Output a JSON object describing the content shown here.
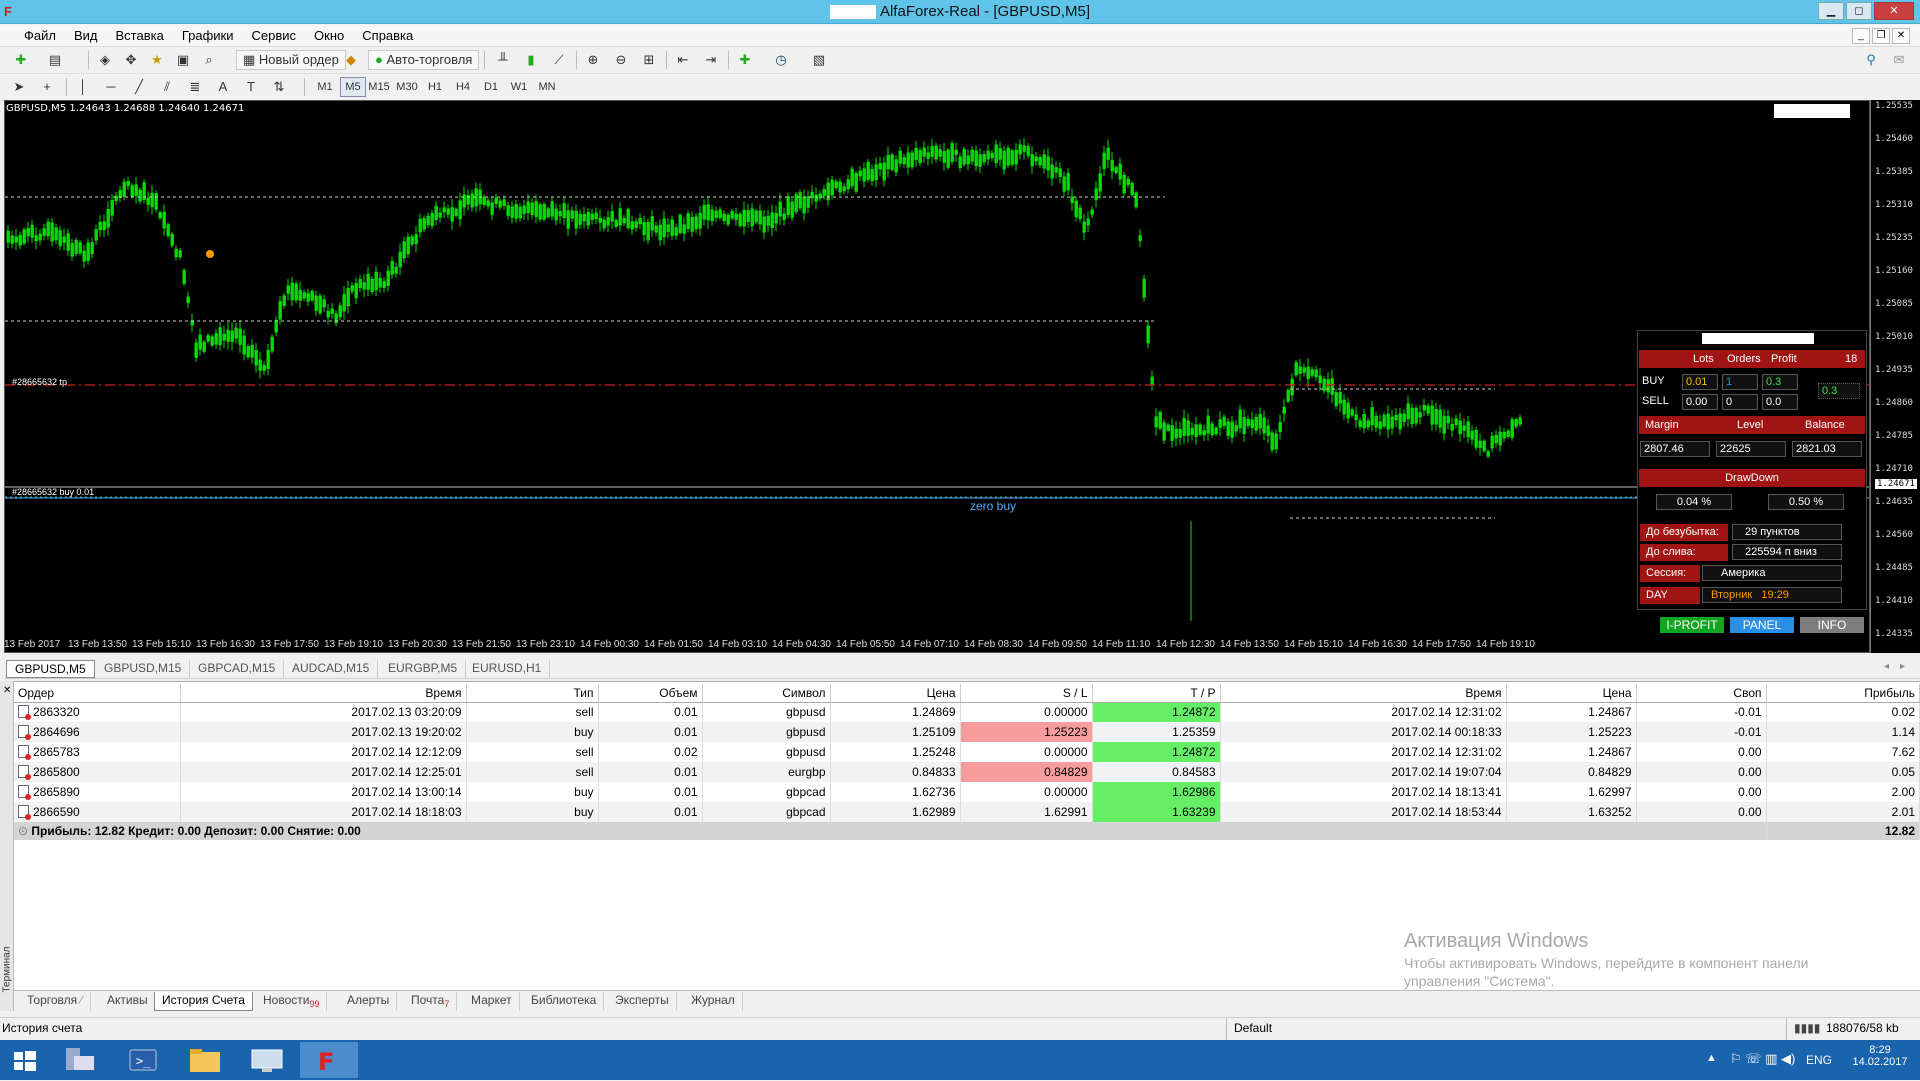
{
  "window": {
    "title": "AlfaForex-Real - [GBPUSD,M5]",
    "controls": {
      "minimize": "▁",
      "maximize": "◻",
      "close": "✕"
    }
  },
  "menu": [
    "Файл",
    "Вид",
    "Вставка",
    "Графики",
    "Сервис",
    "Окно",
    "Справка"
  ],
  "toolbar": {
    "new_order_label": "Новый ордер",
    "autotrade_label": "Авто-торговля",
    "timeframes": [
      "M1",
      "M5",
      "M15",
      "M30",
      "H1",
      "H4",
      "D1",
      "W1",
      "MN"
    ],
    "active_timeframe": "M5"
  },
  "chart": {
    "header": "GBPUSD,M5  1.24643 1.24688 1.24640 1.24671",
    "tp_label": "#28665632 tp",
    "buy_label": "#28665632 buy 0.01",
    "zero_buy_label": "zero buy",
    "current_price": "1.24671",
    "price_ticks": [
      "1.25535",
      "1.25460",
      "1.25385",
      "1.25310",
      "1.25235",
      "1.25160",
      "1.25085",
      "1.25010",
      "1.24935",
      "1.24860",
      "1.24785",
      "1.24710",
      "1.24635",
      "1.24560",
      "1.24485",
      "1.24410",
      "1.24335"
    ],
    "time_ticks": [
      "13 Feb 2017",
      "13 Feb 13:50",
      "13 Feb 15:10",
      "13 Feb 16:30",
      "13 Feb 17:50",
      "13 Feb 19:10",
      "13 Feb 20:30",
      "13 Feb 21:50",
      "13 Feb 23:10",
      "14 Feb 00:30",
      "14 Feb 01:50",
      "14 Feb 03:10",
      "14 Feb 04:30",
      "14 Feb 05:50",
      "14 Feb 07:10",
      "14 Feb 08:30",
      "14 Feb 09:50",
      "14 Feb 11:10",
      "14 Feb 12:30",
      "14 Feb 13:50",
      "14 Feb 15:10",
      "14 Feb 16:30",
      "14 Feb 17:50",
      "14 Feb 19:10"
    ],
    "colors": {
      "candles": "#00dd00",
      "tp_line": "#d02020",
      "zero_line": "#55aaff",
      "dotted": "#cccccc"
    }
  },
  "panel": {
    "col_lots": "Lots",
    "col_orders": "Orders",
    "col_profit": "Profit",
    "count": "18",
    "buy_label": "BUY",
    "sell_label": "SELL",
    "buy_lots": "0.01",
    "buy_orders": "1",
    "buy_profit": "0.3",
    "total_profit": "0.3",
    "sell_lots": "0.00",
    "sell_orders": "0",
    "sell_profit": "0.0",
    "margin_label": "Margin",
    "level_label": "Level",
    "balance_label": "Balance",
    "margin": "2807.46",
    "level": "22625",
    "balance": "2821.03",
    "drawdown_label": "DrawDown",
    "drawdown_1": "0.04 %",
    "drawdown_2": "0.50 %",
    "breakeven_label": "До безубытка:",
    "breakeven": "29 пунктов",
    "stopout_label": "До слива:",
    "stopout": "225594 п вниз",
    "session_label": "Сессия:",
    "session": "Америка",
    "day_label": "DAY",
    "day": "Вторник",
    "time": "19:29",
    "btn_iprofit": "I-PROFIT",
    "btn_panel": "PANEL",
    "btn_info": "INFO"
  },
  "chart_tabs": [
    "GBPUSD,M5",
    "GBPUSD,M15",
    "GBPCAD,M15",
    "AUDCAD,M15",
    "EURGBP,M5",
    "EURUSD,H1"
  ],
  "history": {
    "columns": [
      "Ордер",
      "Время",
      "Тип",
      "Объем",
      "Символ",
      "Цена",
      "S / L",
      "T / P",
      "Время",
      "Цена",
      "Своп",
      "Прибыль"
    ],
    "rows": [
      [
        "2863320",
        "2017.02.13 03:20:09",
        "sell",
        "0.01",
        "gbpusd",
        "1.24869",
        "0.00000",
        "1.24872",
        "2017.02.14 12:31:02",
        "1.24867",
        "-0.01",
        "0.02"
      ],
      [
        "2864696",
        "2017.02.13 19:20:02",
        "buy",
        "0.01",
        "gbpusd",
        "1.25109",
        "1.25223",
        "1.25359",
        "2017.02.14 00:18:33",
        "1.25223",
        "-0.01",
        "1.14"
      ],
      [
        "2865783",
        "2017.02.14 12:12:09",
        "sell",
        "0.02",
        "gbpusd",
        "1.25248",
        "0.00000",
        "1.24872",
        "2017.02.14 12:31:02",
        "1.24867",
        "0.00",
        "7.62"
      ],
      [
        "2865800",
        "2017.02.14 12:25:01",
        "sell",
        "0.01",
        "eurgbp",
        "0.84833",
        "0.84829",
        "0.84583",
        "2017.02.14 19:07:04",
        "0.84829",
        "0.00",
        "0.05"
      ],
      [
        "2865890",
        "2017.02.14 13:00:14",
        "buy",
        "0.01",
        "gbpcad",
        "1.62736",
        "0.00000",
        "1.62986",
        "2017.02.14 18:13:41",
        "1.62997",
        "0.00",
        "2.00"
      ],
      [
        "2866590",
        "2017.02.14 18:18:03",
        "buy",
        "0.01",
        "gbpcad",
        "1.62989",
        "1.62991",
        "1.63239",
        "2017.02.14 18:53:44",
        "1.63252",
        "0.00",
        "2.01"
      ]
    ],
    "highlight": [
      [
        "",
        "green"
      ],
      [
        "red",
        ""
      ],
      [
        "",
        "green"
      ],
      [
        "red",
        ""
      ],
      [
        "",
        "green"
      ],
      [
        "",
        "green"
      ]
    ],
    "total_label": "Прибыль: 12.82  Кредит: 0.00  Депозит: 0.00  Снятие: 0.00",
    "total_value": "12.82"
  },
  "watermark": {
    "title": "Активация Windows",
    "line1": "Чтобы активировать Windows, перейдите в компонент панели",
    "line2": "управления \"Система\"."
  },
  "terminal": {
    "side_label": "Терминал",
    "tabs": [
      "Торговля",
      "Активы",
      "История Счета",
      "Новости",
      "Алерты",
      "Почта",
      "Маркет",
      "Библиотека",
      "Эксперты",
      "Журнал"
    ],
    "news_badge": "99",
    "mail_badge": "7",
    "active_tab": "История Счета"
  },
  "status": {
    "left": "История счета",
    "profile": "Default",
    "traffic": "188076/58 kb"
  },
  "taskbar": {
    "lang": "ENG",
    "time": "8:29",
    "date": "14.02.2017"
  }
}
